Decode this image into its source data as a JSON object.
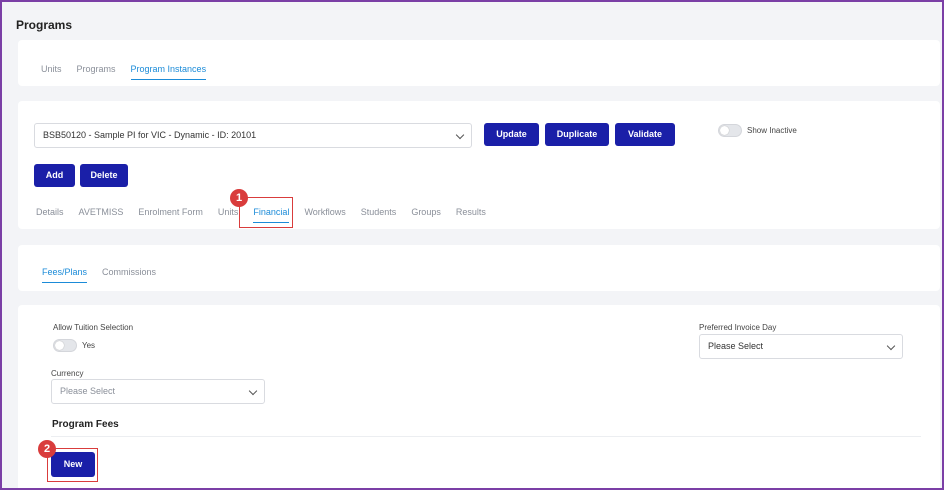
{
  "page": {
    "title": "Programs"
  },
  "top_tabs": [
    {
      "label": "Units",
      "active": false
    },
    {
      "label": "Programs",
      "active": false
    },
    {
      "label": "Program Instances",
      "active": true
    }
  ],
  "instance": {
    "selected": "BSB50120 - Sample PI for VIC - Dynamic - ID: 20101",
    "update_label": "Update",
    "duplicate_label": "Duplicate",
    "validate_label": "Validate",
    "show_inactive_label": "Show Inactive",
    "add_label": "Add",
    "delete_label": "Delete"
  },
  "detail_tabs": [
    {
      "label": "Details",
      "active": false
    },
    {
      "label": "AVETMISS",
      "active": false
    },
    {
      "label": "Enrolment Form",
      "active": false
    },
    {
      "label": "Units",
      "active": false
    },
    {
      "label": "Financial",
      "active": true
    },
    {
      "label": "Workflows",
      "active": false
    },
    {
      "label": "Students",
      "active": false
    },
    {
      "label": "Groups",
      "active": false
    },
    {
      "label": "Results",
      "active": false
    }
  ],
  "financial_tabs": [
    {
      "label": "Fees/Plans",
      "active": true
    },
    {
      "label": "Commissions",
      "active": false
    }
  ],
  "fees": {
    "allow_tuition_label": "Allow Tuition Selection",
    "allow_tuition_value": "Yes",
    "preferred_invoice_label": "Preferred Invoice Day",
    "preferred_invoice_value": "Please Select",
    "currency_label": "Currency",
    "currency_value": "Please Select",
    "program_fees_title": "Program Fees",
    "new_label": "New"
  },
  "markers": {
    "one": "1",
    "two": "2"
  },
  "colors": {
    "primary": "#1a1fa8",
    "accent": "#1b8bd8",
    "highlight": "#d93c3c",
    "frame": "#7b3fa6"
  }
}
